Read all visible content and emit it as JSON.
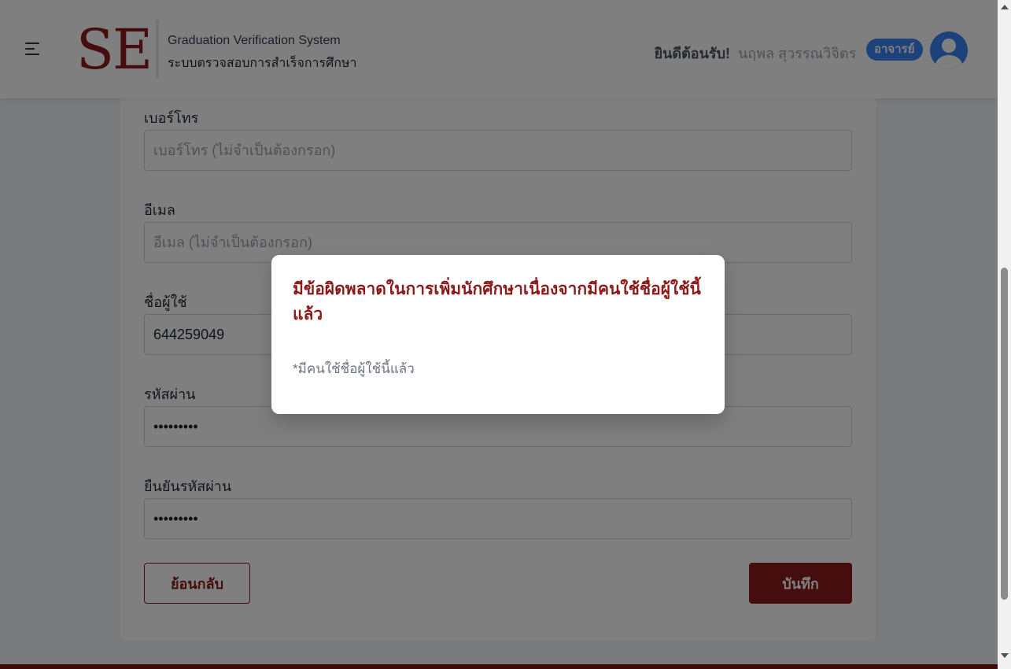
{
  "header": {
    "logo": "SE",
    "system_title_en": "Graduation Verification System",
    "system_title_th": "ระบบตรวจสอบการสำเร็จการศึกษา",
    "welcome": "ยินดีต้อนรับ!",
    "user_name": "นฤพล สุวรรณวิจิตร",
    "role": "อาจารย์"
  },
  "form": {
    "phone": {
      "label": "เบอร์โทร",
      "placeholder": "เบอร์โทร (ไม่จำเป็นต้องกรอก)",
      "value": ""
    },
    "email": {
      "label": "อีเมล",
      "placeholder": "อีเมล (ไม่จำเป็นต้องกรอก)",
      "value": ""
    },
    "username": {
      "label": "ชื่อผู้ใช้",
      "value": "644259049"
    },
    "password": {
      "label": "รหัสผ่าน",
      "value": "•••••••••"
    },
    "confirm_password": {
      "label": "ยืนยันรหัสผ่าน",
      "value": "•••••••••"
    },
    "back_label": "ย้อนกลับ",
    "save_label": "บันทึก"
  },
  "modal": {
    "title": "มีข้อผิดพลาดในการเพิ่มนักศึกษาเนื่องจากมีคนใช้ชื่อผู้ใช้นี้แล้ว",
    "message": "*มีคนใช้ชื่อผู้ใช้นี้แล้ว"
  },
  "colors": {
    "brand": "#8b1a1a",
    "badge": "#3b82f6"
  }
}
